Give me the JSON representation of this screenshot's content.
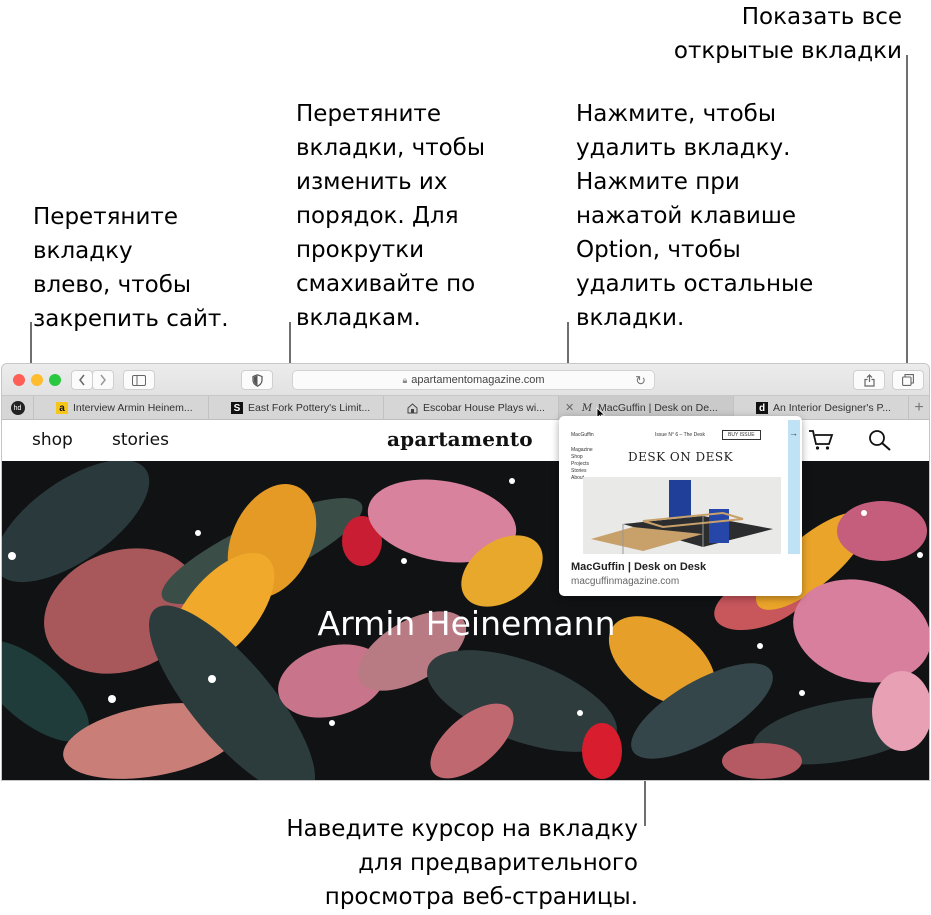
{
  "annotations": {
    "show_all_tabs": "Показать все\nоткрытые вкладки",
    "reorder_tabs": "Перетяните\nвкладки, чтобы\nизменить их\nпорядок. Для\nпрокрутки\nсмахивайте по\nвкладкам.",
    "close_tab": "Нажмите, чтобы\nудалить вкладку.\nНажмите при\nнажатой клавише\nOption, чтобы\nудалить остальные\nвкладки.",
    "pin_tab": "Перетяните\nвкладку\nвлево, чтобы\nзакрепить сайт.",
    "hover_preview": "Наведите курсор на вкладку\nдля предварительного\nпросмотра веб-страницы."
  },
  "toolbar": {
    "back_icon": "chevron-left-icon",
    "forward_icon": "chevron-right-icon",
    "sidebar_icon": "sidebar-icon",
    "privacy_icon": "shield-icon",
    "address": "apartamentomagazine.com",
    "share_icon": "share-icon",
    "tabs_overview_icon": "tabs-overview-icon"
  },
  "tabs": {
    "pinned_icon": "pinned-site-icon",
    "items": [
      {
        "label": "Interview Armin Heinem...",
        "favicon": "a"
      },
      {
        "label": "East Fork Pottery's Limit...",
        "favicon": "S"
      },
      {
        "label": "Escobar House Plays wi...",
        "favicon": "house"
      },
      {
        "label": "MacGuffin | Desk on De...",
        "favicon": "M"
      },
      {
        "label": "An Interior Designer's P...",
        "favicon": "d"
      }
    ],
    "new_tab": "+"
  },
  "page": {
    "nav_shop": "shop",
    "nav_stories": "stories",
    "logo": "apartamento",
    "hero_title": "Armin Heinemann"
  },
  "preview": {
    "site_brand": "MacGuffin",
    "issue": "Issue N° 6 – The Desk",
    "buy": "BUY ISSUE",
    "menu": [
      "Magazine",
      "Shop",
      "Projects",
      "Stories",
      "About"
    ],
    "heading": "DESK ON DESK",
    "title": "MacGuffin | Desk on Desk",
    "url": "macguffinmagazine.com"
  },
  "colors": {
    "close": "#fe5f57",
    "minimize": "#febc2e",
    "zoom": "#28c840",
    "callout": "#6f6f6f"
  }
}
